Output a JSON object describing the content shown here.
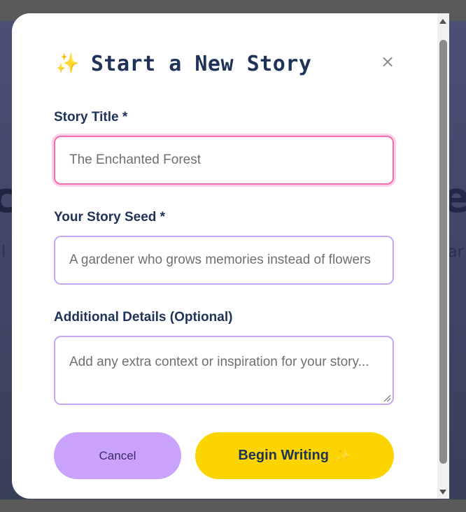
{
  "modal": {
    "title": "Start a New Story",
    "title_icon": "sparkles-icon",
    "close_label": "×"
  },
  "form": {
    "story_title": {
      "label": "Story Title *",
      "value": "The Enchanted Forest"
    },
    "story_seed": {
      "label": "Your Story Seed *",
      "value": "A gardener who grows memories instead of flowers"
    },
    "details": {
      "label": "Additional Details (Optional)",
      "placeholder": "Add any extra context or inspiration for your story..."
    }
  },
  "actions": {
    "cancel_label": "Cancel",
    "begin_label": "Begin Writing",
    "begin_icon": "sparkles-icon"
  },
  "colors": {
    "cancel_bg": "#c9a3fb",
    "begin_bg": "#fcd500",
    "title_text": "#1e3357",
    "field_border": "#c9a8f2",
    "focused_border": "#ef6fb0"
  }
}
